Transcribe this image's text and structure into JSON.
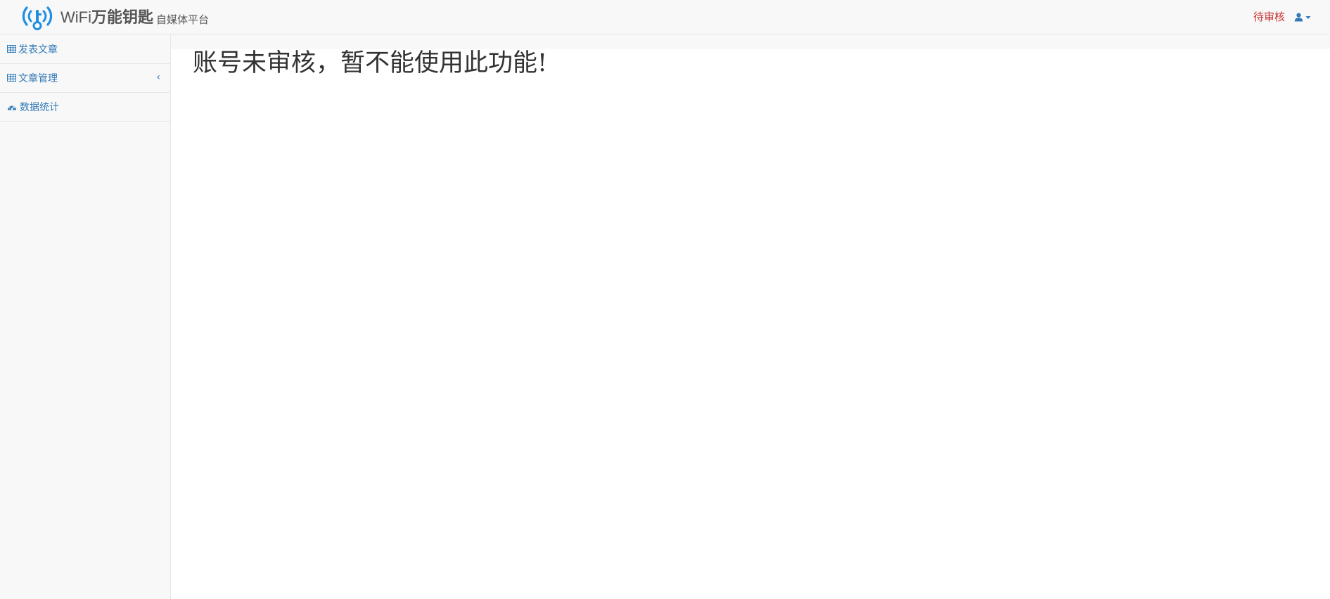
{
  "header": {
    "brand_name_latin": "WiFi",
    "brand_name_cn": "万能钥匙",
    "brand_subtitle": "自媒体平台",
    "status_link": "待审核",
    "logo_icon": "wifi-key-logo-icon",
    "user_icon": "user-icon",
    "caret_icon": "caret-down-icon"
  },
  "sidebar": {
    "items": [
      {
        "label": "发表文章",
        "icon": "table-icon"
      },
      {
        "label": "文章管理",
        "icon": "table-icon",
        "chevron": "‹"
      },
      {
        "label": "数据统计",
        "icon": "dashboard-icon"
      }
    ]
  },
  "main": {
    "notice": "账号未审核，暂不能使用此功能!"
  },
  "colors": {
    "link": "#337ab7",
    "status": "#c9302c",
    "logo": "#1e8fe1",
    "navbar_bg": "#f8f8f8"
  }
}
